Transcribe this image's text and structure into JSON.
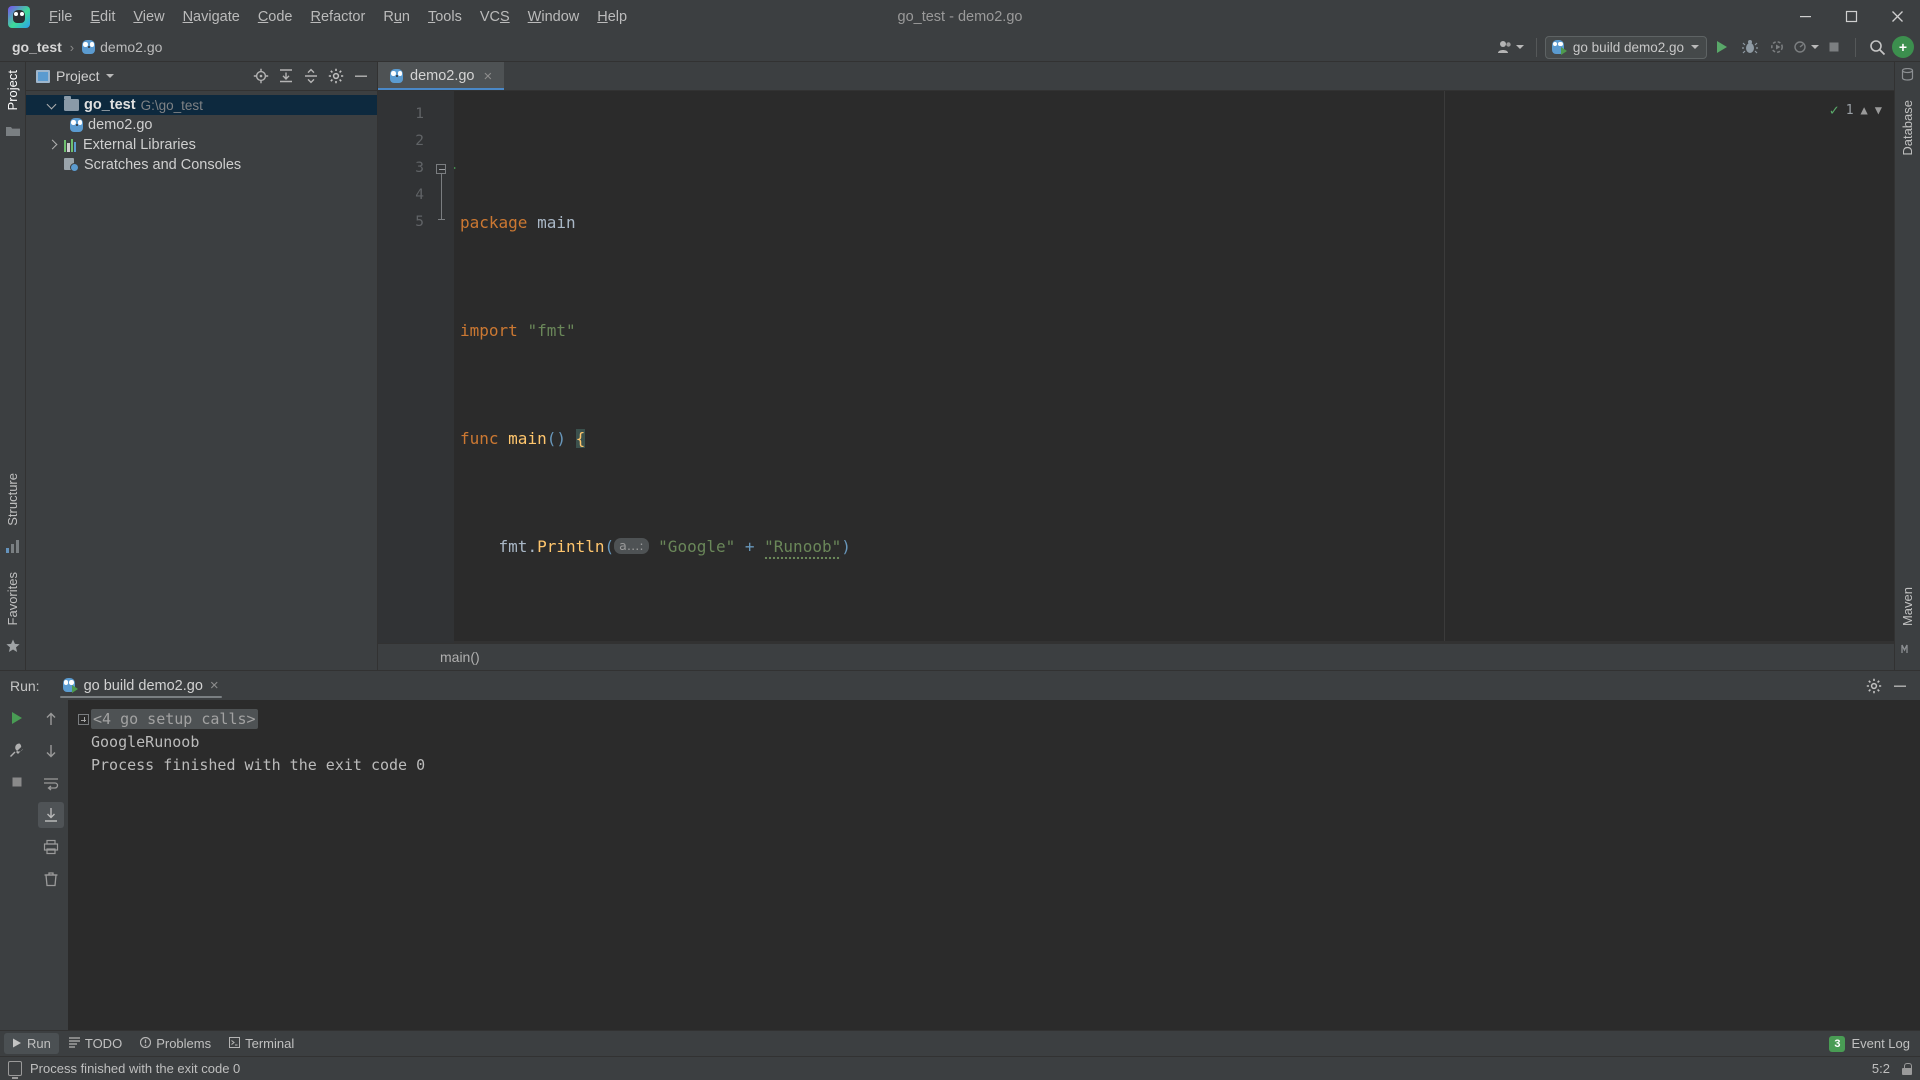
{
  "window": {
    "title": "go_test - demo2.go",
    "controls": {
      "minimize": "minimize-icon",
      "maximize": "maximize-icon",
      "close": "close-icon"
    }
  },
  "menu": {
    "items": [
      {
        "label": "File",
        "mnemonic": "F"
      },
      {
        "label": "Edit",
        "mnemonic": "E"
      },
      {
        "label": "View",
        "mnemonic": "V"
      },
      {
        "label": "Navigate",
        "mnemonic": "N"
      },
      {
        "label": "Code",
        "mnemonic": "C"
      },
      {
        "label": "Refactor",
        "mnemonic": "R"
      },
      {
        "label": "Run",
        "mnemonic": "u"
      },
      {
        "label": "Tools",
        "mnemonic": "T"
      },
      {
        "label": "VCS",
        "mnemonic": "S"
      },
      {
        "label": "Window",
        "mnemonic": "W"
      },
      {
        "label": "Help",
        "mnemonic": "H"
      }
    ]
  },
  "breadcrumbs": {
    "project": "go_test",
    "separator": "›",
    "file": "demo2.go"
  },
  "toolbar": {
    "account_icon": "user-account-icon",
    "run_config": "go build demo2.go",
    "run_button": "run-icon",
    "debug_button": "debug-icon",
    "coverage_button": "run-with-coverage-icon",
    "profile_button": "profile-icon",
    "stop_button": "stop-icon",
    "search_button": "search-icon",
    "updates_badge": "+"
  },
  "left_strip": {
    "project_tab": "Project",
    "structure_tab": "Structure",
    "favorites_tab": "Favorites"
  },
  "right_strip": {
    "database_tab": "Database",
    "maven_tab": "Maven"
  },
  "project_panel": {
    "title": "Project",
    "actions": [
      "locate-icon",
      "expand-all-icon",
      "collapse-all-icon",
      "settings-icon",
      "hide-icon"
    ],
    "tree": [
      {
        "label": "go_test",
        "path": "G:\\go_test",
        "icon": "folder-icon",
        "depth": 0,
        "expanded": true,
        "selected": true
      },
      {
        "label": "demo2.go",
        "path": "",
        "icon": "go-file-icon",
        "depth": 1,
        "expanded": null,
        "selected": false
      },
      {
        "label": "External Libraries",
        "path": "",
        "icon": "libraries-icon",
        "depth": 0,
        "expanded": false,
        "selected": false
      },
      {
        "label": "Scratches and Consoles",
        "path": "",
        "icon": "scratches-icon",
        "depth": 0,
        "expanded": null,
        "selected": false
      }
    ]
  },
  "editor": {
    "tab": {
      "label": "demo2.go",
      "icon": "go-file-icon",
      "close": "×"
    },
    "gutter_lines": [
      "1",
      "2",
      "3",
      "4",
      "5"
    ],
    "run_marker_line": 3,
    "code": {
      "line1": {
        "kw": "package",
        "name": "main"
      },
      "line2": {
        "kw": "import",
        "str": "\"fmt\""
      },
      "line3": {
        "kw": "func",
        "fn": "main",
        "parens": "()",
        "brace": "{"
      },
      "line4": {
        "pkg": "fmt",
        "dot": ".",
        "fn": "Println",
        "open": "(",
        "hint": "a…:",
        "str1": "\"Google\"",
        "op": "+",
        "str2": "\"Runoob\"",
        "close": ")"
      },
      "line5": {
        "brace": "}"
      }
    },
    "inspection": {
      "status": "ok-check-icon",
      "count": "1"
    },
    "breadcrumb": "main()"
  },
  "run_panel": {
    "label": "Run:",
    "tab": {
      "label": "go build demo2.go",
      "icon": "go-run-icon",
      "close": "×"
    },
    "actions": [
      "settings-icon",
      "hide-icon"
    ],
    "sidebar_buttons": [
      "rerun-icon",
      "wrench-icon",
      "stop-icon"
    ],
    "sidebar2_buttons": [
      "scroll-up-icon",
      "scroll-down-icon",
      "soft-wrap-icon",
      "scroll-to-end-icon",
      "print-icon",
      "clear-all-icon"
    ],
    "console": {
      "collapsed_line": "<4 go setup calls>",
      "output": "GoogleRunoob",
      "blank": "",
      "exit": "Process finished with the exit code 0"
    }
  },
  "toolwindow_bar": {
    "items": [
      {
        "label": "Run",
        "icon": "run-icon",
        "selected": true
      },
      {
        "label": "TODO",
        "icon": "todo-icon",
        "selected": false
      },
      {
        "label": "Problems",
        "icon": "problems-icon",
        "selected": false
      },
      {
        "label": "Terminal",
        "icon": "terminal-icon",
        "selected": false
      }
    ],
    "event_log": {
      "count": "3",
      "label": "Event Log"
    }
  },
  "statusbar": {
    "message": "Process finished with the exit code 0",
    "caret_position": "5:2",
    "lock_icon": "lock-icon",
    "memory_icon": "status-indicator-icon"
  },
  "colors": {
    "bg": "#3c3f41",
    "editor_bg": "#2b2b2b",
    "gutter_bg": "#313335",
    "selection": "#0d293e",
    "keyword": "#cc7832",
    "string": "#6a8759",
    "function": "#ffc66d",
    "number": "#6897bb",
    "text": "#a9b7c6",
    "accent": "#4a88c7",
    "green": "#499c54"
  }
}
